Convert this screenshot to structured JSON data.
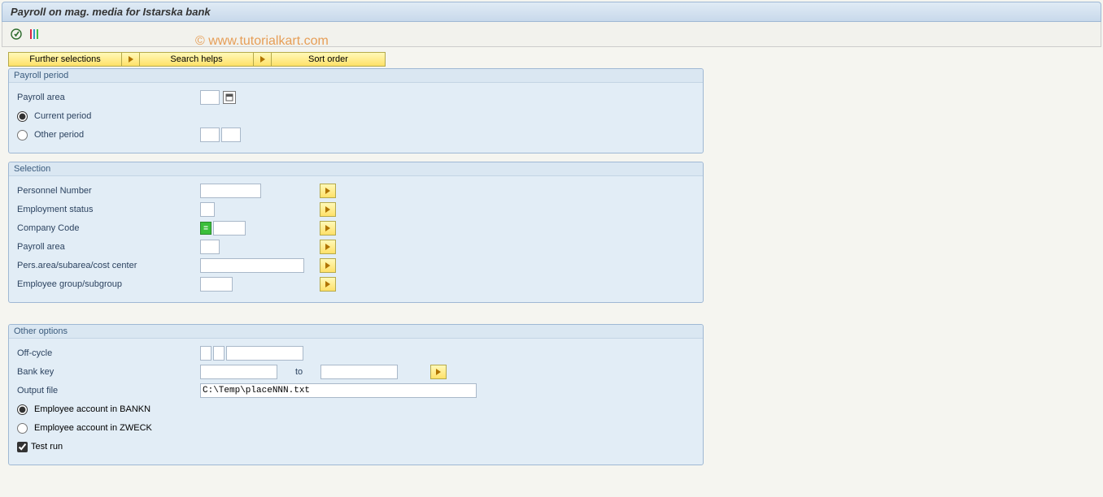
{
  "title": "Payroll on mag. media for Istarska bank",
  "watermark": "© www.tutorialkart.com",
  "buttons": {
    "further_selections": "Further selections",
    "search_helps": "Search helps",
    "sort_order": "Sort order"
  },
  "groups": {
    "payroll_period": {
      "title": "Payroll period",
      "payroll_area_label": "Payroll area",
      "current_period_label": "Current period",
      "other_period_label": "Other period",
      "period_selected": "current"
    },
    "selection": {
      "title": "Selection",
      "personnel_number_label": "Personnel Number",
      "employment_status_label": "Employment status",
      "company_code_label": "Company Code",
      "payroll_area_label": "Payroll area",
      "pers_area_label": "Pers.area/subarea/cost center",
      "employee_group_label": "Employee group/subgroup"
    },
    "other_options": {
      "title": "Other options",
      "off_cycle_label": "Off-cycle",
      "bank_key_label": "Bank key",
      "bank_key_to": "to",
      "output_file_label": "Output file",
      "output_file_value": "C:\\Temp\\placeNNN.txt",
      "account_bankn_label": "Employee account in BANKN",
      "account_zweck_label": "Employee account in ZWECK",
      "account_selected": "bankn",
      "test_run_label": "Test run",
      "test_run_checked": true
    }
  }
}
